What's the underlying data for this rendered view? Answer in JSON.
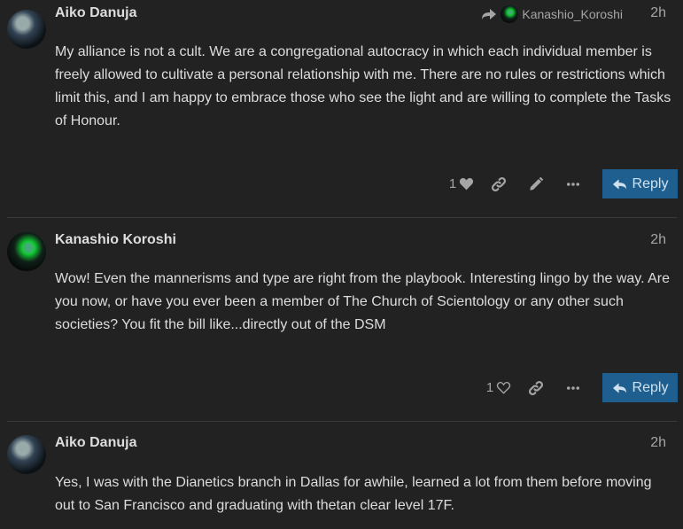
{
  "posts": [
    {
      "username": "Aiko Danuja",
      "time": "2h",
      "reply_to": "Kanashio_Koroshi",
      "body": "My alliance is not a cult. We are a congregational autocracy in which each individual member is freely allowed to cultivate a personal relationship with me. There are no rules or restrictions which limit this, and I am happy to embrace those who see the light and are willing to complete the Tasks of Honour.",
      "likes": "1",
      "reply_label": "Reply"
    },
    {
      "username": "Kanashio Koroshi",
      "time": "2h",
      "body": "Wow! Even the mannerisms and type are right from the playbook. Interesting lingo by the way. Are you now, or have you ever been a member of The Church of Scientology or any other such societies? You fit the bill like...directly out of the DSM",
      "likes": "1",
      "reply_label": "Reply"
    },
    {
      "username": "Aiko Danuja",
      "time": "2h",
      "body": "Yes, I was with the Dianetics branch in Dallas for awhile, learned a lot from them before moving out to San Francisco and graduating with thetan clear level 17F."
    }
  ],
  "colors": {
    "background": "#222222",
    "text": "#dddddd",
    "muted": "#a5a5a5",
    "reply_button": "#1f5f8f"
  },
  "icons": [
    "heart-icon",
    "link-icon",
    "pencil-icon",
    "more-icon",
    "reply-arrow-icon",
    "share-arrow-icon"
  ]
}
